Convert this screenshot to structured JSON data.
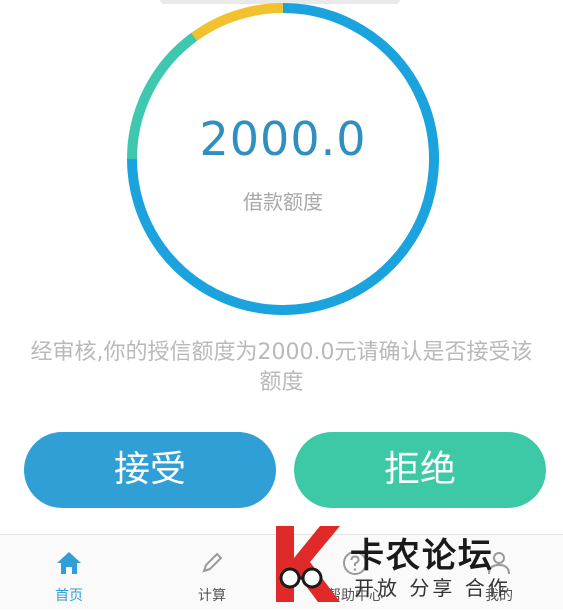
{
  "credit": {
    "amount": "2000.0",
    "label": "借款额度",
    "ring_segments": [
      {
        "share": 0.35,
        "color": "#1aa3dd"
      },
      {
        "share": 0.4,
        "color": "#1aa3dd"
      },
      {
        "share": 0.15,
        "color": "#3fc8b0"
      },
      {
        "share": 0.1,
        "color": "#f2c12e"
      }
    ]
  },
  "message": "经审核,你的授信额度为2000.0元请确认是否接受该额度",
  "buttons": {
    "accept": "接受",
    "reject": "拒绝"
  },
  "tabs": [
    {
      "label": "首页",
      "icon": "home-icon",
      "active": true
    },
    {
      "label": "计算",
      "icon": "pencil-icon",
      "active": false
    },
    {
      "label": "帮助中心",
      "icon": "help-icon",
      "active": false
    },
    {
      "label": "我的",
      "icon": "user-icon",
      "active": false
    }
  ],
  "watermark": {
    "title": "卡农论坛",
    "subtitle": "开放 分享 合作"
  },
  "colors": {
    "accent": "#2f9fd6",
    "accept": "#2f9fd6",
    "reject": "#3ec9a6",
    "ring_blue": "#1aa3dd",
    "ring_teal": "#3fc8b0",
    "ring_yellow": "#f2c12e"
  }
}
